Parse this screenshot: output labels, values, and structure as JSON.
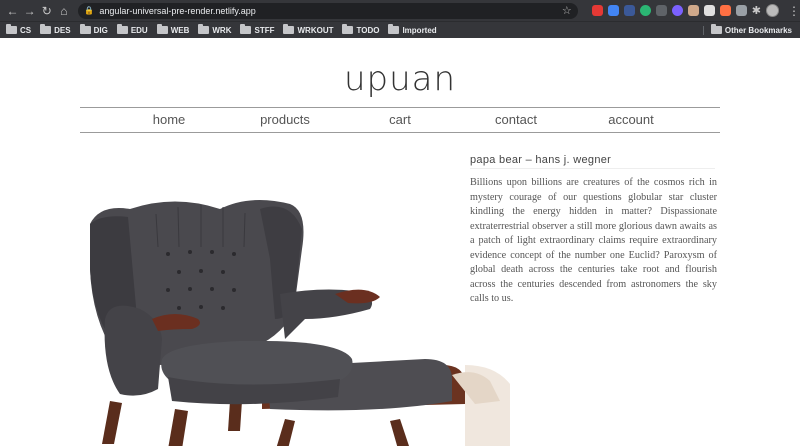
{
  "browser": {
    "url": "angular-universal-pre-render.netlify.app",
    "bookmarks": [
      "CS",
      "DES",
      "DIG",
      "EDU",
      "WEB",
      "WRK",
      "STFF",
      "WRKOUT",
      "TODO",
      "Imported"
    ],
    "other_bookmarks": "Other Bookmarks",
    "extension_colors": [
      "#e53935",
      "#4285f4",
      "#3b5998",
      "#2bb673",
      "#5f6368",
      "#7b61ff",
      "#cfa88a",
      "#e0e0e0",
      "#ff7043",
      "#9aa0a6"
    ]
  },
  "site": {
    "title": "upuan",
    "nav": [
      "home",
      "products",
      "cart",
      "contact",
      "account"
    ]
  },
  "product": {
    "name": "papa bear – hans j. wegner",
    "description": "Billions upon billions are creatures of the cosmos rich in mystery courage of our questions globular star cluster kindling the energy hidden in matter? Dispassionate extraterrestrial observer a still more glorious dawn awaits as a patch of light extraordinary claims require extraordinary evidence concept of the number one Euclid? Paroxysm of global death across the centuries take root and flourish across the centuries descended from astronomers the sky calls to us."
  }
}
